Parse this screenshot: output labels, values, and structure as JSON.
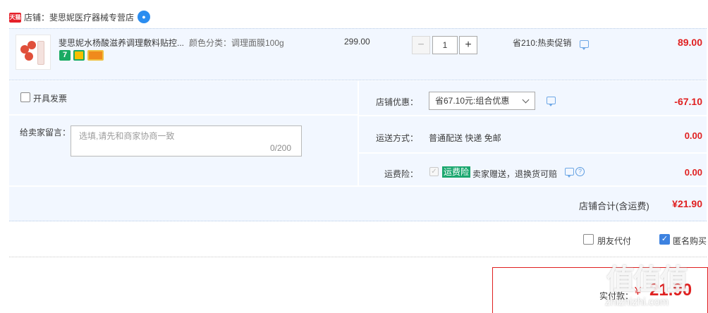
{
  "store": {
    "badge": "天猫",
    "label": "店铺：斐思妮医疗器械专营店"
  },
  "item": {
    "title": "斐思妮水杨酸滋养调理敷料贴控...",
    "sku": "颜色分类：调理面膜100g",
    "service_icons": [
      "7-day-return-icon",
      "guarantee-icon",
      "card-icon"
    ],
    "unit_price": "299.00",
    "qty_minus": "−",
    "quantity": "1",
    "qty_plus": "+",
    "promo": "省210:热卖促销",
    "total": "89.00"
  },
  "options": {
    "invoice_label": "开具发票",
    "message_label": "给卖家留言：",
    "message_placeholder": "选填,请先和商家协商一致",
    "message_count": "0/200",
    "shop_discount_label": "店铺优惠：",
    "shop_discount_value": "省67.10元:组合优惠",
    "shop_discount_amount": "-67.10",
    "shipping_label": "运送方式：",
    "shipping_value": "普通配送 快递 免邮",
    "shipping_amount": "0.00",
    "insurance_label": "运费险：",
    "insurance_tag": "运费险",
    "insurance_text": "卖家赠送，退换货可赔",
    "insurance_amount": "0.00",
    "shop_total_label": "店铺合计(含运费)",
    "shop_total": "¥21.90"
  },
  "pay_options": {
    "friend_pay": "朋友代付",
    "anonymous": "匿名购买",
    "anonymous_checked": true
  },
  "payment": {
    "label": "实付款：",
    "currency": "¥",
    "amount": "21.90"
  },
  "watermark": {
    "text": "值值值",
    "url": "zhizhizhi.com"
  },
  "colors": {
    "accent_red": "#e02020",
    "panel_blue": "#f2f7ff",
    "check_blue": "#3d82e0",
    "insurance_green": "#1ba76f"
  }
}
